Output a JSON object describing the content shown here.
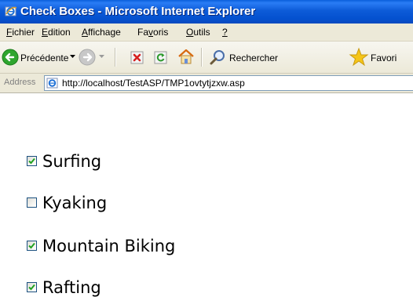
{
  "window": {
    "title": "Check Boxes - Microsoft Internet Explorer"
  },
  "menu": [
    {
      "hot": "F",
      "rest": "ichier"
    },
    {
      "hot": "E",
      "rest": "dition"
    },
    {
      "hot": "A",
      "rest": "ffichage"
    },
    {
      "pre": "Fa",
      "hot": "v",
      "rest": "oris"
    },
    {
      "hot": "O",
      "rest": "utils"
    },
    {
      "hot": "?",
      "rest": ""
    }
  ],
  "toolbar": {
    "back_label": "Précédente",
    "search_label": "Rechercher",
    "favorites_label": "Favori"
  },
  "address": {
    "label": "Address",
    "url": "http://localhost/TestASP/TMP1ovtytjzxw.asp"
  },
  "options": [
    {
      "label": "Surfing",
      "checked": true
    },
    {
      "label": "Kyaking",
      "checked": false
    },
    {
      "label": "Mountain Biking",
      "checked": true
    },
    {
      "label": "Rafting",
      "checked": true
    }
  ],
  "colors": {
    "titlebar": "#0453d0",
    "chrome": "#ece9d8",
    "checkmark": "#21a121"
  }
}
